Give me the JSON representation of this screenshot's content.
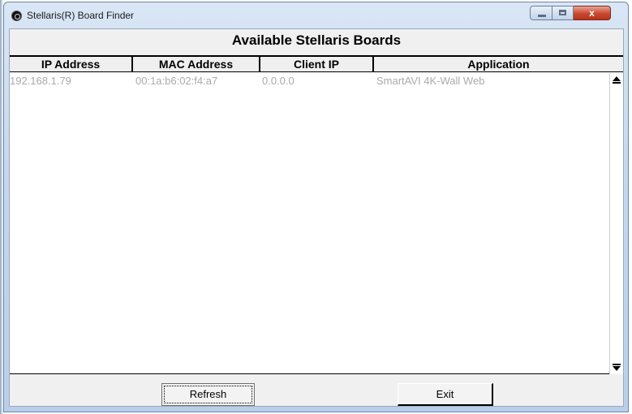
{
  "window": {
    "title": "Stellaris(R) Board Finder",
    "close_glyph": "x",
    "icons": [
      "app-icon",
      "minimize-icon",
      "maximize-icon",
      "close-icon"
    ]
  },
  "main": {
    "heading": "Available Stellaris Boards",
    "columns": [
      "IP Address",
      "MAC Address",
      "Client IP",
      "Application"
    ],
    "rows": [
      [
        "192.168.1.79",
        "00:1a:b6:02:f4:a7",
        "0.0.0.0",
        "SmartAVI 4K-Wall Web"
      ]
    ]
  },
  "buttons": {
    "refresh": "Refresh",
    "exit": "Exit"
  },
  "colors": {
    "row_text": "#aaaaaa",
    "close_button": "#c9482f"
  }
}
